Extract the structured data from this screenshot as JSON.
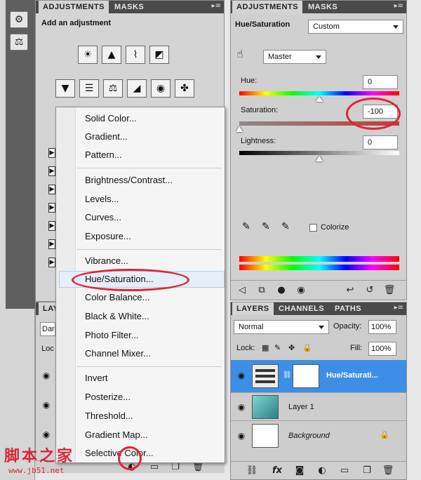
{
  "left_panel": {
    "tabs": [
      "ADJUSTMENTS",
      "MASKS"
    ],
    "heading": "Add an adjustment",
    "row1_icons": [
      "brightness-icon",
      "levels-icon",
      "curves-icon",
      "exposure-icon"
    ],
    "row2_icons": [
      "vibrance-icon",
      "hue-icon",
      "balance-icon",
      "bw-icon",
      "photo-filter-icon",
      "mixer-icon"
    ],
    "layers_tab": "LAYE",
    "blend_short": "Dar",
    "lock_short": "Loc"
  },
  "menu": {
    "groups": [
      [
        "Solid Color...",
        "Gradient...",
        "Pattern..."
      ],
      [
        "Brightness/Contrast...",
        "Levels...",
        "Curves...",
        "Exposure..."
      ],
      [
        "Vibrance...",
        "Hue/Saturation...",
        "Color Balance...",
        "Black & White...",
        "Photo Filter...",
        "Channel Mixer..."
      ],
      [
        "Invert",
        "Posterize...",
        "Threshold...",
        "Gradient Map...",
        "Selective Color..."
      ]
    ],
    "g1": [
      "Solid Color...",
      "Gradient...",
      "Pattern..."
    ],
    "g2": [
      "Brightness/Contrast...",
      "Levels...",
      "Curves...",
      "Exposure..."
    ],
    "g3": [
      "Vibrance...",
      "Hue/Saturation...",
      "Color Balance...",
      "Black & White...",
      "Photo Filter...",
      "Channel Mixer..."
    ],
    "g4": [
      "Invert",
      "Posterize...",
      "Threshold...",
      "Gradient Map...",
      "Selective Color..."
    ]
  },
  "right_panel": {
    "tabs": [
      "ADJUSTMENTS",
      "MASKS"
    ],
    "title": "Hue/Saturation",
    "preset": "Custom",
    "channel": "Master",
    "hue_label": "Hue:",
    "hue_value": "0",
    "saturation_label": "Saturation:",
    "saturation_value": "-100",
    "lightness_label": "Lightness:",
    "lightness_value": "0",
    "colorize_label": "Colorize",
    "hue_fraction": 0.5,
    "saturation_fraction": 0.0,
    "lightness_fraction": 0.5
  },
  "layers_panel": {
    "tabs": [
      "LAYERS",
      "CHANNELS",
      "PATHS"
    ],
    "blend_mode": "Normal",
    "opacity_label": "Opacity:",
    "opacity_value": "100%",
    "lock_label": "Lock:",
    "fill_label": "Fill:",
    "fill_value": "100%",
    "layers": [
      "Hue/Saturati...",
      "Layer 1",
      "Background"
    ]
  },
  "watermark": {
    "text": "脚本之家",
    "url": "www.jb51.net"
  },
  "colors": {
    "highlight_circle": "#e0243a",
    "selected_layer": "#3d8ee6"
  }
}
